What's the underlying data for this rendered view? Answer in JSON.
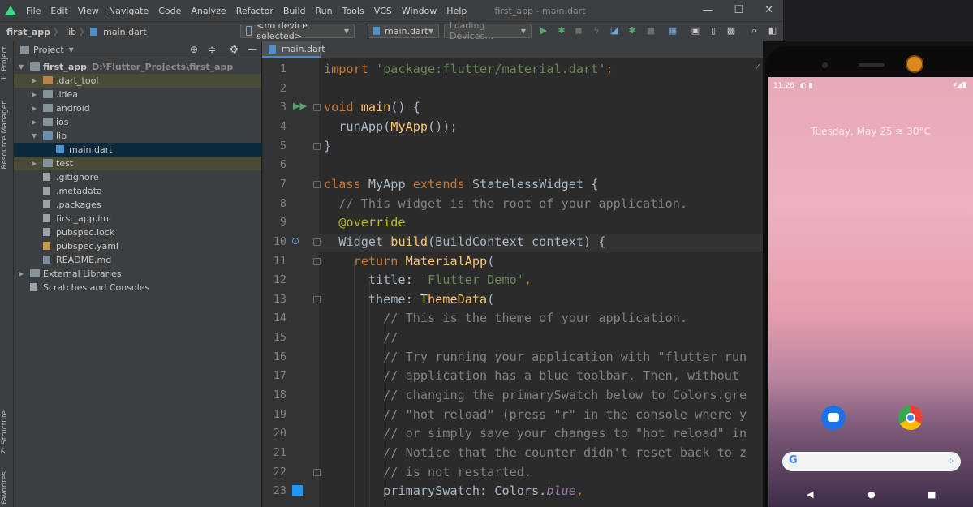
{
  "menubar": {
    "items": [
      "File",
      "Edit",
      "View",
      "Navigate",
      "Code",
      "Analyze",
      "Refactor",
      "Build",
      "Run",
      "Tools",
      "VCS",
      "Window",
      "Help"
    ],
    "window_title": "first_app - main.dart",
    "window_controls": [
      "—",
      "☐",
      "✕"
    ]
  },
  "navbar": {
    "breadcrumbs": [
      "first_app",
      "lib",
      "main.dart"
    ],
    "device_selector": "<no device selected>",
    "run_config": "main.dart",
    "devices_combo": "Loading Devices..."
  },
  "sidebar_strip": {
    "project": "1: Project",
    "resource_manager": "Resource Manager",
    "structure": "Z: Structure",
    "favorites": "Favorites"
  },
  "project_panel": {
    "title": "Project",
    "tree": [
      {
        "label": "first_app",
        "sub": "D:\\Flutter_Projects\\first_app",
        "level": 0,
        "expanded": true,
        "icon": "folder"
      },
      {
        "label": ".dart_tool",
        "level": 1,
        "expanded": false,
        "icon": "folder-orange",
        "highlight": true
      },
      {
        "label": ".idea",
        "level": 1,
        "expanded": false,
        "icon": "folder"
      },
      {
        "label": "android",
        "level": 1,
        "expanded": false,
        "icon": "folder"
      },
      {
        "label": "ios",
        "level": 1,
        "expanded": false,
        "icon": "folder"
      },
      {
        "label": "lib",
        "level": 1,
        "expanded": true,
        "icon": "folder-blue"
      },
      {
        "label": "main.dart",
        "level": 2,
        "icon": "file-dart",
        "selected": true
      },
      {
        "label": "test",
        "level": 1,
        "expanded": false,
        "icon": "folder",
        "highlight2": true
      },
      {
        "label": ".gitignore",
        "level": 1,
        "icon": "file"
      },
      {
        "label": ".metadata",
        "level": 1,
        "icon": "file"
      },
      {
        "label": ".packages",
        "level": 1,
        "icon": "file"
      },
      {
        "label": "first_app.iml",
        "level": 1,
        "icon": "file"
      },
      {
        "label": "pubspec.lock",
        "level": 1,
        "icon": "file"
      },
      {
        "label": "pubspec.yaml",
        "level": 1,
        "icon": "file-yaml"
      },
      {
        "label": "README.md",
        "level": 1,
        "icon": "file-md"
      },
      {
        "label": "External Libraries",
        "level": 0,
        "expanded": false,
        "icon": "folder"
      },
      {
        "label": "Scratches and Consoles",
        "level": 0,
        "icon": "file"
      }
    ]
  },
  "editor": {
    "tab": "main.dart",
    "line_numbers": [
      "1",
      "2",
      "3",
      "4",
      "5",
      "6",
      "7",
      "8",
      "9",
      "10",
      "11",
      "12",
      "13",
      "14",
      "15",
      "16",
      "17",
      "18",
      "19",
      "20",
      "21",
      "22",
      "23"
    ],
    "lines": [
      [
        [
          "kw",
          "import "
        ],
        [
          "str",
          "'package:flutter/material.dart'"
        ],
        [
          "kw",
          ";"
        ]
      ],
      [],
      [
        [
          "kw",
          "void "
        ],
        [
          "fn",
          "main"
        ],
        [
          "",
          "() {"
        ]
      ],
      [
        [
          "",
          "  runApp("
        ],
        [
          "fn",
          "MyApp"
        ],
        [
          "",
          "());"
        ]
      ],
      [
        [
          "",
          "}"
        ]
      ],
      [],
      [
        [
          "kw",
          "class "
        ],
        [
          "",
          "MyApp "
        ],
        [
          "kw",
          "extends "
        ],
        [
          "",
          "StatelessWidget {"
        ]
      ],
      [
        [
          "cmt",
          "  // This widget is the root of your application."
        ]
      ],
      [
        [
          "ann",
          "  @override"
        ]
      ],
      [
        [
          "",
          "  Widget "
        ],
        [
          "fn",
          "build"
        ],
        [
          "",
          "(BuildContext context) {"
        ]
      ],
      [
        [
          "kw",
          "    return "
        ],
        [
          "fn",
          "MaterialApp"
        ],
        [
          "",
          "("
        ]
      ],
      [
        [
          "",
          "      title: "
        ],
        [
          "str",
          "'Flutter Demo'"
        ],
        [
          "kw",
          ","
        ]
      ],
      [
        [
          "",
          "      theme: "
        ],
        [
          "fn",
          "ThemeData"
        ],
        [
          "",
          "("
        ]
      ],
      [
        [
          "cmt",
          "        // This is the theme of your application."
        ]
      ],
      [
        [
          "cmt",
          "        //"
        ]
      ],
      [
        [
          "cmt",
          "        // Try running your application with \"flutter run"
        ]
      ],
      [
        [
          "cmt",
          "        // application has a blue toolbar. Then, without "
        ]
      ],
      [
        [
          "cmt",
          "        // changing the primarySwatch below to Colors.gre"
        ]
      ],
      [
        [
          "cmt",
          "        // \"hot reload\" (press \"r\" in the console where y"
        ]
      ],
      [
        [
          "cmt",
          "        // or simply save your changes to \"hot reload\" in"
        ]
      ],
      [
        [
          "cmt",
          "        // Notice that the counter didn't reset back to z"
        ]
      ],
      [
        [
          "cmt",
          "        // is not restarted."
        ]
      ],
      [
        [
          "",
          "        primarySwatch: Colors."
        ],
        [
          "it",
          "blue"
        ],
        [
          "kw",
          ","
        ]
      ]
    ]
  },
  "emulator": {
    "time": "11:26",
    "date_weather": "Tuesday, May 25  ≋ 30°C",
    "nav_back": "◀",
    "nav_home": "●",
    "nav_recent": "■"
  },
  "colors": {
    "accent": "#4a88c7",
    "keyword": "#cc7832",
    "string": "#6a8759",
    "comment": "#808080",
    "function": "#ffc66d",
    "run_green": "#59a869"
  }
}
